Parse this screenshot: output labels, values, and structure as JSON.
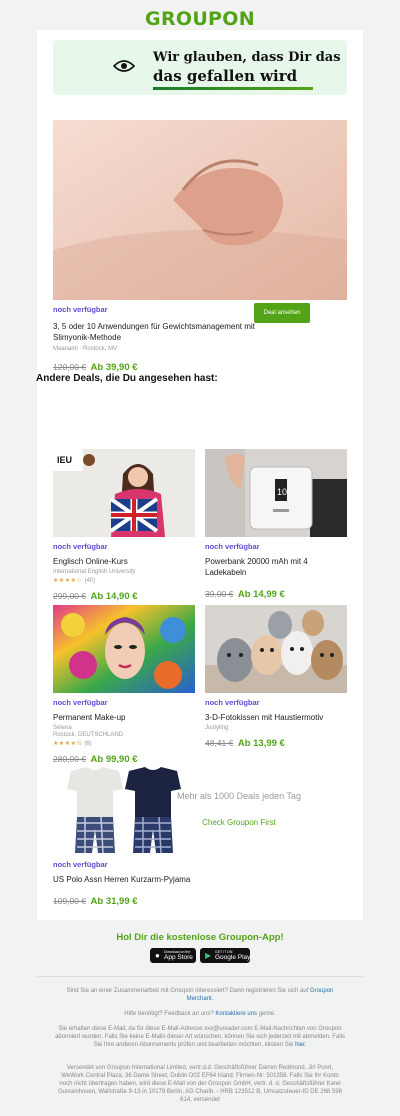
{
  "header": {
    "logo": "GROUPON"
  },
  "banner": {
    "line1": "Wir glauben, dass Dir das",
    "line2": "das gefallen wird"
  },
  "hero": {
    "availability": "noch verfügbar",
    "title": "3, 5 oder 10 Anwendungen für Gewichtsmanagement mit Slimyonik-Methode",
    "merchant": "Maanami",
    "location": "Rostock, MV",
    "old_price": "120,00 €",
    "new_price": "Ab 39,90 €",
    "button": "Deal ansehen"
  },
  "section_title": "Andere Deals, die Du angesehen hast:",
  "deals": [
    {
      "availability": "noch verfügbar",
      "title": "Englisch Online-Kurs",
      "merchant": "International English University",
      "rating": "★★★★☆",
      "reviews": "(40)",
      "old_price": "299,00 €",
      "new_price": "Ab 14,90 €"
    },
    {
      "availability": "noch verfügbar",
      "title": "Powerbank 20000 mAh mit 4 Ladekabeln",
      "old_price": "39,00 €",
      "new_price": "Ab 14,99 €"
    },
    {
      "availability": "noch verfügbar",
      "title": "Permanent Make-up",
      "merchant": "Selena",
      "location": "Rostock, DEUTSCHLAND",
      "rating": "★★★★½",
      "reviews": "(6)",
      "old_price": "280,00 €",
      "new_price": "Ab 99,90 €"
    },
    {
      "availability": "noch verfügbar",
      "title": "3-D-Fotokissen mit Haustiermotiv",
      "merchant": "Justyling",
      "old_price": "48,41 €",
      "new_price": "Ab 13,99 €"
    },
    {
      "availability": "noch verfügbar",
      "title": "US Polo Assn Herren Kurzarm-Pyjama",
      "old_price": "109,00 €",
      "new_price": "Ab 31,99 €"
    }
  ],
  "promo": {
    "text": "Mehr als 1000 Deals jeden Tag",
    "link": "Check Groupon First"
  },
  "app": {
    "title": "Hol Dir die kostenlose Groupon-App!",
    "appstore_small": "Download on the",
    "appstore": "App Store",
    "googleplay_small": "GET IT ON",
    "googleplay": "Google Play"
  },
  "footer": {
    "merchant_text": "Sind Sie an einer Zusammenarbeit mit Groupon interessiert? Dann registrieren Sie sich auf",
    "merchant_link": "Groupon Merchant",
    "help_text": "Hilfe benötigt? Feedback an uns?",
    "help_link": "Kontaktiere uns",
    "help_suffix": "gerne.",
    "info_text": "Sie erhalten diese E-Mail, da für diese E-Mail-Adresse xxx@ureader.com E-Mail-Nachrichten von Groupon abonniert wurden. Falls Sie keine E-Mails dieser Art wünschen, können Sie sich jederzeit mit abmelden. Falls Sie Ihre anderen Abonnements prüfen und bearbeiten möchten, klicken Sie",
    "info_link": "hier.",
    "legal": "Versendet von Groupon International Limited, vertr.d.d. Geschäftsführer Darren Redmond, Jiri Ponrt, WeWork Central Plaza, 36 Dame Street, Dublin D02 EF64 Irland, Firmen-Nr: 501358. Falls Sie Ihr Konto noch nicht übertragen haben, wird diese E-Mail von der Groupon GmbH, vertr. d. d. Geschäftsführer Karel Gussenhoven, Wallstraße 9-13 in 10179 Berlin, AG Charlb. - HRB 123512 B, Umsatzsteuer-ID DE 268 596 614, versendet"
  }
}
